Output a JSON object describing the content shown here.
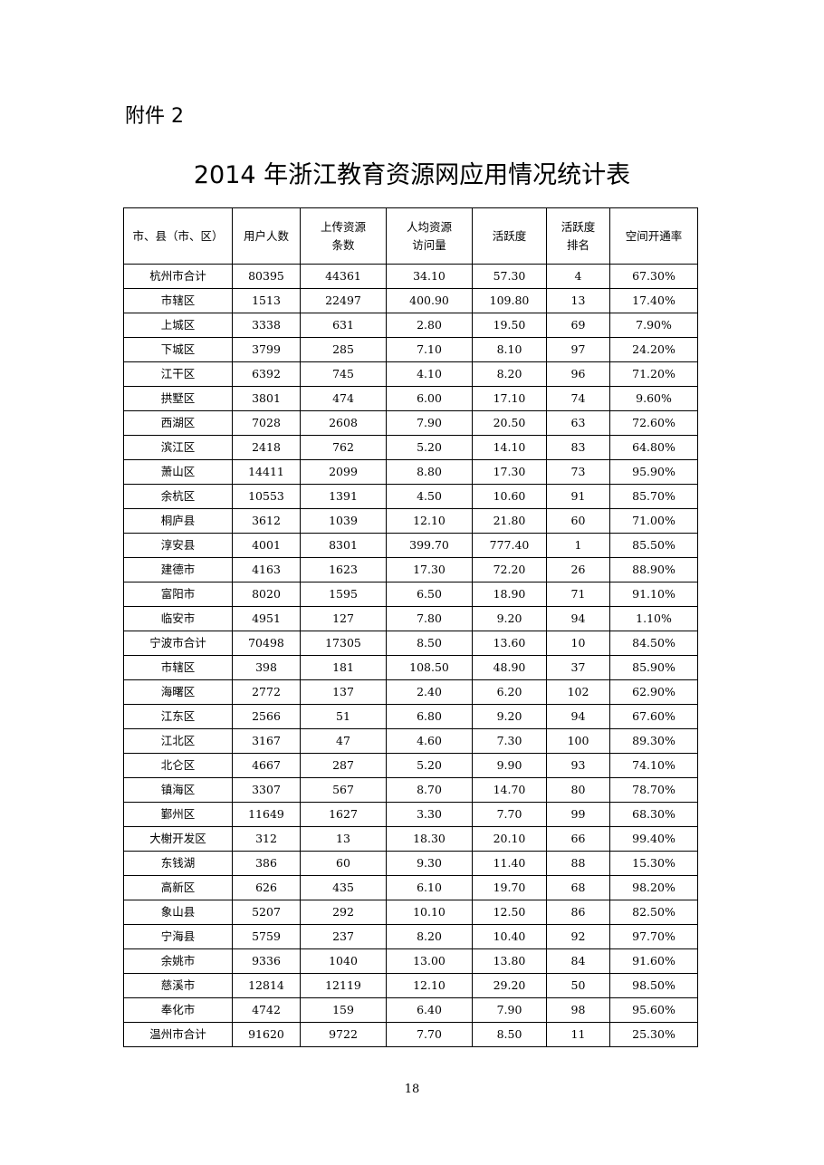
{
  "attachment_label": "附件 2",
  "title": "2014 年浙江教育资源网应用情况统计表",
  "table": {
    "headers": [
      [
        "市、县（市、区）"
      ],
      [
        "用户人数"
      ],
      [
        "上传资源",
        "条数"
      ],
      [
        "人均资源",
        "访问量"
      ],
      [
        "活跃度"
      ],
      [
        "活跃度",
        "排名"
      ],
      [
        "空间开通率"
      ]
    ],
    "rows": [
      [
        "杭州市合计",
        "80395",
        "44361",
        "34.10",
        "57.30",
        "4",
        "67.30%"
      ],
      [
        "市辖区",
        "1513",
        "22497",
        "400.90",
        "109.80",
        "13",
        "17.40%"
      ],
      [
        "上城区",
        "3338",
        "631",
        "2.80",
        "19.50",
        "69",
        "7.90%"
      ],
      [
        "下城区",
        "3799",
        "285",
        "7.10",
        "8.10",
        "97",
        "24.20%"
      ],
      [
        "江干区",
        "6392",
        "745",
        "4.10",
        "8.20",
        "96",
        "71.20%"
      ],
      [
        "拱墅区",
        "3801",
        "474",
        "6.00",
        "17.10",
        "74",
        "9.60%"
      ],
      [
        "西湖区",
        "7028",
        "2608",
        "7.90",
        "20.50",
        "63",
        "72.60%"
      ],
      [
        "滨江区",
        "2418",
        "762",
        "5.20",
        "14.10",
        "83",
        "64.80%"
      ],
      [
        "萧山区",
        "14411",
        "2099",
        "8.80",
        "17.30",
        "73",
        "95.90%"
      ],
      [
        "余杭区",
        "10553",
        "1391",
        "4.50",
        "10.60",
        "91",
        "85.70%"
      ],
      [
        "桐庐县",
        "3612",
        "1039",
        "12.10",
        "21.80",
        "60",
        "71.00%"
      ],
      [
        "淳安县",
        "4001",
        "8301",
        "399.70",
        "777.40",
        "1",
        "85.50%"
      ],
      [
        "建德市",
        "4163",
        "1623",
        "17.30",
        "72.20",
        "26",
        "88.90%"
      ],
      [
        "富阳市",
        "8020",
        "1595",
        "6.50",
        "18.90",
        "71",
        "91.10%"
      ],
      [
        "临安市",
        "4951",
        "127",
        "7.80",
        "9.20",
        "94",
        "1.10%"
      ],
      [
        "宁波市合计",
        "70498",
        "17305",
        "8.50",
        "13.60",
        "10",
        "84.50%"
      ],
      [
        "市辖区",
        "398",
        "181",
        "108.50",
        "48.90",
        "37",
        "85.90%"
      ],
      [
        "海曙区",
        "2772",
        "137",
        "2.40",
        "6.20",
        "102",
        "62.90%"
      ],
      [
        "江东区",
        "2566",
        "51",
        "6.80",
        "9.20",
        "94",
        "67.60%"
      ],
      [
        "江北区",
        "3167",
        "47",
        "4.60",
        "7.30",
        "100",
        "89.30%"
      ],
      [
        "北仑区",
        "4667",
        "287",
        "5.20",
        "9.90",
        "93",
        "74.10%"
      ],
      [
        "镇海区",
        "3307",
        "567",
        "8.70",
        "14.70",
        "80",
        "78.70%"
      ],
      [
        "鄞州区",
        "11649",
        "1627",
        "3.30",
        "7.70",
        "99",
        "68.30%"
      ],
      [
        "大榭开发区",
        "312",
        "13",
        "18.30",
        "20.10",
        "66",
        "99.40%"
      ],
      [
        "东钱湖",
        "386",
        "60",
        "9.30",
        "11.40",
        "88",
        "15.30%"
      ],
      [
        "高新区",
        "626",
        "435",
        "6.10",
        "19.70",
        "68",
        "98.20%"
      ],
      [
        "象山县",
        "5207",
        "292",
        "10.10",
        "12.50",
        "86",
        "82.50%"
      ],
      [
        "宁海县",
        "5759",
        "237",
        "8.20",
        "10.40",
        "92",
        "97.70%"
      ],
      [
        "余姚市",
        "9336",
        "1040",
        "13.00",
        "13.80",
        "84",
        "91.60%"
      ],
      [
        "慈溪市",
        "12814",
        "12119",
        "12.10",
        "29.20",
        "50",
        "98.50%"
      ],
      [
        "奉化市",
        "4742",
        "159",
        "6.40",
        "7.90",
        "98",
        "95.60%"
      ],
      [
        "温州市合计",
        "91620",
        "9722",
        "7.70",
        "8.50",
        "11",
        "25.30%"
      ]
    ]
  },
  "page_number": "18"
}
